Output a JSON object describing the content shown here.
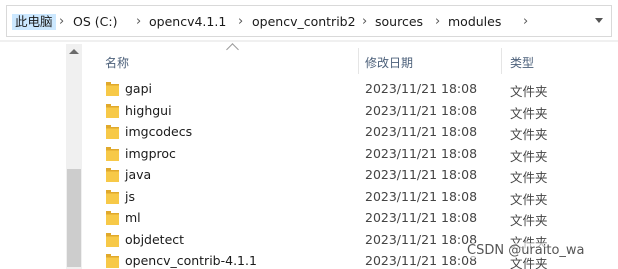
{
  "address": {
    "crumbs": [
      "此电脑",
      "OS (C:)",
      "opencv4.1.1",
      "opencv_contrib2",
      "sources",
      "modules"
    ],
    "separator": "›"
  },
  "columns": {
    "name": "名称",
    "date": "修改日期",
    "type": "类型"
  },
  "files": [
    {
      "name": "gapi",
      "date": "2023/11/21 18:08",
      "type": "文件夹"
    },
    {
      "name": "highgui",
      "date": "2023/11/21 18:08",
      "type": "文件夹"
    },
    {
      "name": "imgcodecs",
      "date": "2023/11/21 18:08",
      "type": "文件夹"
    },
    {
      "name": "imgproc",
      "date": "2023/11/21 18:08",
      "type": "文件夹"
    },
    {
      "name": "java",
      "date": "2023/11/21 18:08",
      "type": "文件夹"
    },
    {
      "name": "js",
      "date": "2023/11/21 18:08",
      "type": "文件夹"
    },
    {
      "name": "ml",
      "date": "2023/11/21 18:08",
      "type": "文件夹"
    },
    {
      "name": "objdetect",
      "date": "2023/11/21 18:08",
      "type": "文件夹"
    },
    {
      "name": "opencv_contrib-4.1.1",
      "date": "2023/11/21 18:08",
      "type": "文件夹"
    }
  ],
  "watermark": "CSDN @uraito_wa",
  "colors": {
    "folder": "#f7c948",
    "folder_dark": "#e0a92c",
    "selected_crumb": "#cce8ff"
  }
}
